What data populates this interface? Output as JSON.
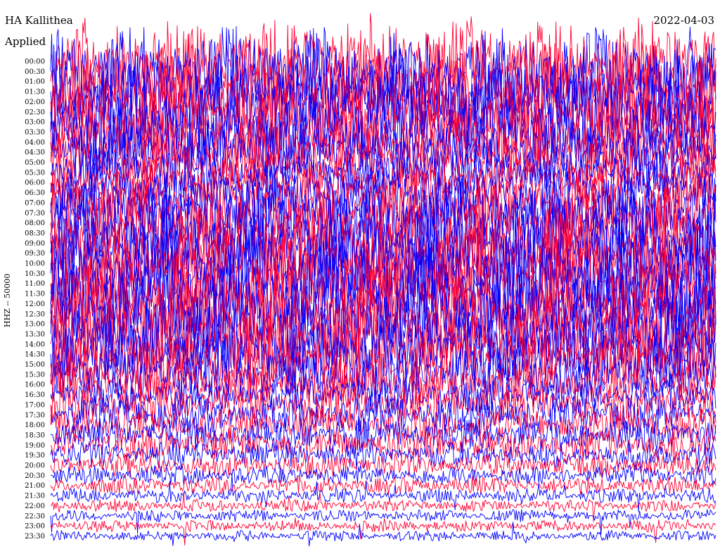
{
  "header": {
    "station": "HA Kallithea",
    "subtitle": "Applied",
    "date": "2022-04-03"
  },
  "chart_data": {
    "type": "line",
    "title": "HA Kallithea",
    "ylabel": "HHZ -- 50000",
    "x_range_minutes_per_line": 30,
    "lines": [
      {
        "time": "00:00",
        "activity": 0.95
      },
      {
        "time": "00:30",
        "activity": 0.95
      },
      {
        "time": "01:00",
        "activity": 0.95
      },
      {
        "time": "01:30",
        "activity": 0.95
      },
      {
        "time": "02:00",
        "activity": 0.95
      },
      {
        "time": "02:30",
        "activity": 0.95
      },
      {
        "time": "03:00",
        "activity": 0.95
      },
      {
        "time": "03:30",
        "activity": 0.9
      },
      {
        "time": "04:00",
        "activity": 0.85
      },
      {
        "time": "04:30",
        "activity": 0.8
      },
      {
        "time": "05:00",
        "activity": 0.75
      },
      {
        "time": "05:30",
        "activity": 0.7
      },
      {
        "time": "06:00",
        "activity": 0.7
      },
      {
        "time": "06:30",
        "activity": 0.75
      },
      {
        "time": "07:00",
        "activity": 0.8
      },
      {
        "time": "07:30",
        "activity": 0.85
      },
      {
        "time": "08:00",
        "activity": 0.9
      },
      {
        "time": "08:30",
        "activity": 0.95
      },
      {
        "time": "09:00",
        "activity": 0.95
      },
      {
        "time": "09:30",
        "activity": 0.95
      },
      {
        "time": "10:00",
        "activity": 0.95
      },
      {
        "time": "10:30",
        "activity": 0.95
      },
      {
        "time": "11:00",
        "activity": 0.95
      },
      {
        "time": "11:30",
        "activity": 0.95
      },
      {
        "time": "12:00",
        "activity": 0.95
      },
      {
        "time": "12:30",
        "activity": 0.95
      },
      {
        "time": "13:00",
        "activity": 0.95
      },
      {
        "time": "13:30",
        "activity": 0.95
      },
      {
        "time": "14:00",
        "activity": 0.9
      },
      {
        "time": "14:30",
        "activity": 0.85
      },
      {
        "time": "15:00",
        "activity": 0.8
      },
      {
        "time": "15:30",
        "activity": 0.75
      },
      {
        "time": "16:00",
        "activity": 0.65
      },
      {
        "time": "16:30",
        "activity": 0.6
      },
      {
        "time": "17:00",
        "activity": 0.6
      },
      {
        "time": "17:30",
        "activity": 0.6
      },
      {
        "time": "18:00",
        "activity": 0.55
      },
      {
        "time": "18:30",
        "activity": 0.55
      },
      {
        "time": "19:00",
        "activity": 0.5
      },
      {
        "time": "19:30",
        "activity": 0.45
      },
      {
        "time": "20:00",
        "activity": 0.4
      },
      {
        "time": "20:30",
        "activity": 0.35
      },
      {
        "time": "21:00",
        "activity": 0.3
      },
      {
        "time": "21:30",
        "activity": 0.22
      },
      {
        "time": "22:00",
        "activity": 0.18
      },
      {
        "time": "22:30",
        "activity": 0.16
      },
      {
        "time": "23:00",
        "activity": 0.14
      },
      {
        "time": "23:30",
        "activity": 0.1
      }
    ],
    "colors": [
      "#ff0033",
      "#0000ff"
    ],
    "grid": false,
    "legend": "none"
  }
}
